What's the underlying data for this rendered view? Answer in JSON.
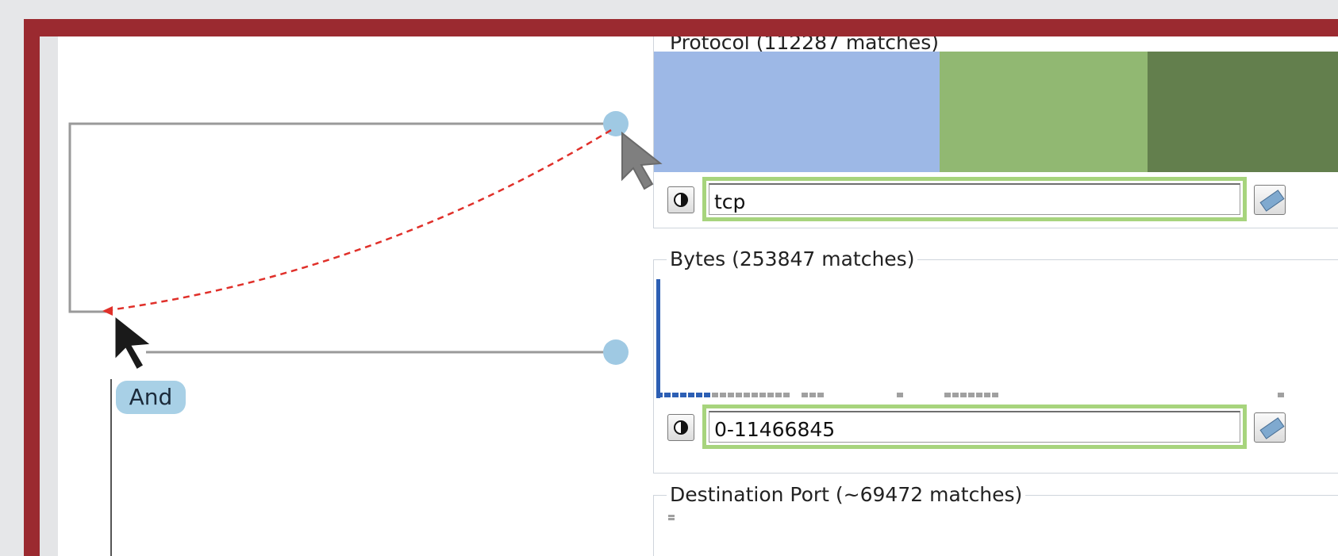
{
  "canvas": {
    "and_node_label": "And"
  },
  "panels": {
    "protocol": {
      "title": "Protocol (112287 matches)",
      "bar_colors": [
        "#9db8e6",
        "#91b872",
        "#637f4d"
      ],
      "filter_value": "tcp"
    },
    "bytes": {
      "title": "Bytes (253847 matches)",
      "filter_value": "0-11466845"
    },
    "destination_port": {
      "title": "Destination Port (~69472 matches)"
    }
  },
  "icons": {
    "invert": "invert-icon",
    "eraser": "eraser-icon",
    "cursor": "mouse-cursor-icon",
    "drag_arrow": "drag-arrow-icon"
  },
  "colors": {
    "frame": "#9b2a30",
    "field_border": "#a7d47d",
    "node_fill": "#a8d0e6",
    "connector_dot": "#9fc9e3",
    "hist_selected": "#2d5fb4",
    "hist_unselected": "#a0a0a0",
    "drag_arrow": "#e0302a"
  }
}
